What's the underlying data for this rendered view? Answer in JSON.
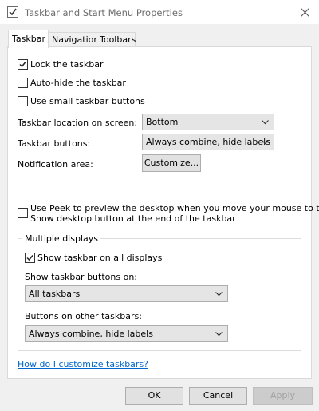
{
  "window": {
    "title": "Taskbar and Start Menu Properties",
    "icons": {
      "app": "app-window-check-icon",
      "close": "close-icon"
    }
  },
  "tabs": [
    {
      "label": "Taskbar",
      "active": true
    },
    {
      "label": "Navigation",
      "active": false
    },
    {
      "label": "Toolbars",
      "active": false
    }
  ],
  "options": {
    "lock_taskbar": {
      "label": "Lock the taskbar",
      "checked": true
    },
    "auto_hide": {
      "label": "Auto-hide the taskbar",
      "checked": false
    },
    "small_buttons": {
      "label": "Use small taskbar buttons",
      "checked": false
    }
  },
  "location": {
    "label": "Taskbar location on screen:",
    "value": "Bottom"
  },
  "buttons_setting": {
    "label": "Taskbar buttons:",
    "value": "Always combine, hide labels"
  },
  "notification": {
    "label": "Notification area:",
    "button": "Customize..."
  },
  "peek": {
    "line1": "Use Peek to preview the desktop when you move your mouse to the",
    "line2": "Show desktop button at the end of the taskbar",
    "checked": false
  },
  "multiple_displays": {
    "title": "Multiple displays",
    "show_all": {
      "label": "Show taskbar on all displays",
      "checked": true
    },
    "show_buttons_on": {
      "label": "Show taskbar buttons on:",
      "value": "All taskbars"
    },
    "other_taskbars": {
      "label": "Buttons on other taskbars:",
      "value": "Always combine, hide labels"
    }
  },
  "help_link": "How do I customize taskbars?",
  "footer": {
    "ok": "OK",
    "cancel": "Cancel",
    "apply": "Apply"
  },
  "colors": {
    "link": "#0066cc",
    "panel": "#ffffff",
    "window": "#f0f0f0"
  }
}
